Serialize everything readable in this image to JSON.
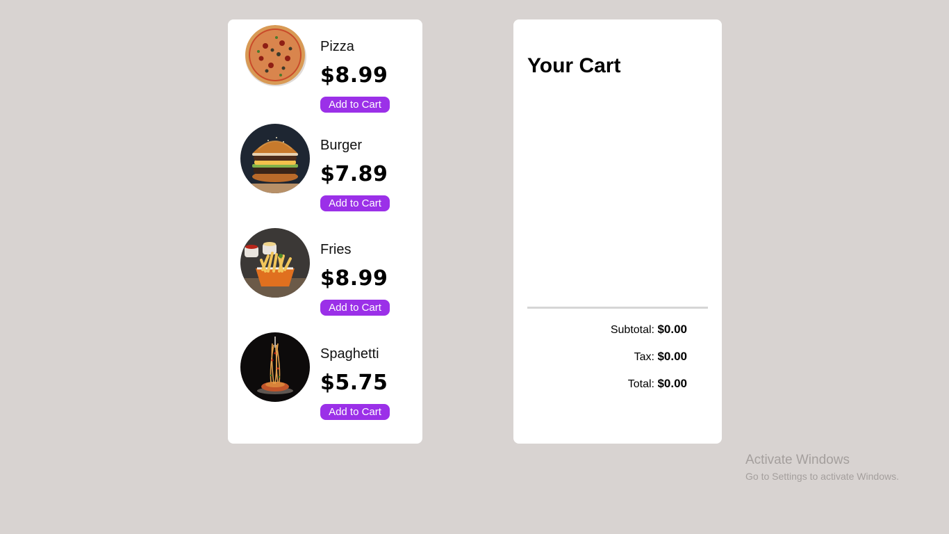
{
  "menu": {
    "items": [
      {
        "name": "Pizza",
        "price": "$8.99",
        "button": "Add to Cart",
        "image": "pizza"
      },
      {
        "name": "Burger",
        "price": "$7.89",
        "button": "Add to Cart",
        "image": "burger"
      },
      {
        "name": "Fries",
        "price": "$8.99",
        "button": "Add to Cart",
        "image": "fries"
      },
      {
        "name": "Spaghetti",
        "price": "$5.75",
        "button": "Add to Cart",
        "image": "spaghetti"
      }
    ]
  },
  "cart": {
    "title": "Your Cart",
    "items": [],
    "subtotal_label": "Subtotal:",
    "subtotal_value": "$0.00",
    "tax_label": "Tax:",
    "tax_value": "$0.00",
    "total_label": "Total:",
    "total_value": "$0.00"
  },
  "watermark": {
    "title": "Activate Windows",
    "subtitle": "Go to Settings to activate Windows."
  },
  "colors": {
    "background": "#d8d3d1",
    "card": "#ffffff",
    "accent": "#9b30e8"
  }
}
